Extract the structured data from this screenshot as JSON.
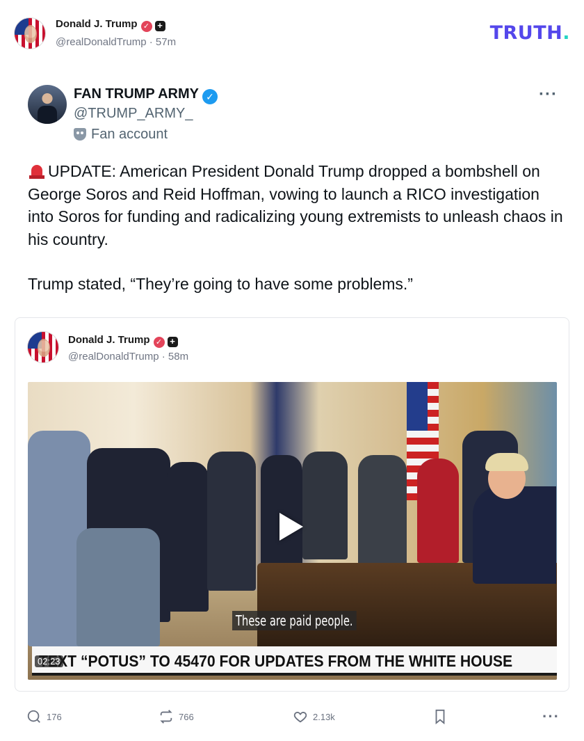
{
  "truth_post": {
    "author_name": "Donald J. Trump",
    "handle": "@realDonaldTrump",
    "time": "57m",
    "logo_text": "TRUTH",
    "logo_dot": "."
  },
  "embedded_tweet": {
    "author_name": "FAN TRUMP ARMY",
    "handle": "@TRUMP_ARMY_",
    "account_label": "Fan account",
    "paragraph_1": "UPDATE: American President Donald Trump dropped a bombshell on George Soros and Reid Hoffman, vowing to launch a RICO investigation into Soros for funding and radicalizing young extremists to unleash chaos in his country.",
    "paragraph_2": "Trump stated, “They’re going to have some problems.”"
  },
  "quoted_post": {
    "author_name": "Donald J. Trump",
    "handle": "@realDonaldTrump",
    "time": "58m",
    "video": {
      "subtitle": "These are paid people.",
      "ticker": "TEXT “POTUS” TO 45470 FOR UPDATES FROM THE WHITE HOUSE",
      "timecode": "02:23"
    }
  },
  "actions": {
    "replies": "176",
    "retruths": "766",
    "likes": "2.13k"
  },
  "colors": {
    "truth_purple": "#5447eb",
    "truth_teal": "#26d5c4",
    "verified_red": "#e3445a",
    "verified_blue": "#1d9bf0"
  }
}
